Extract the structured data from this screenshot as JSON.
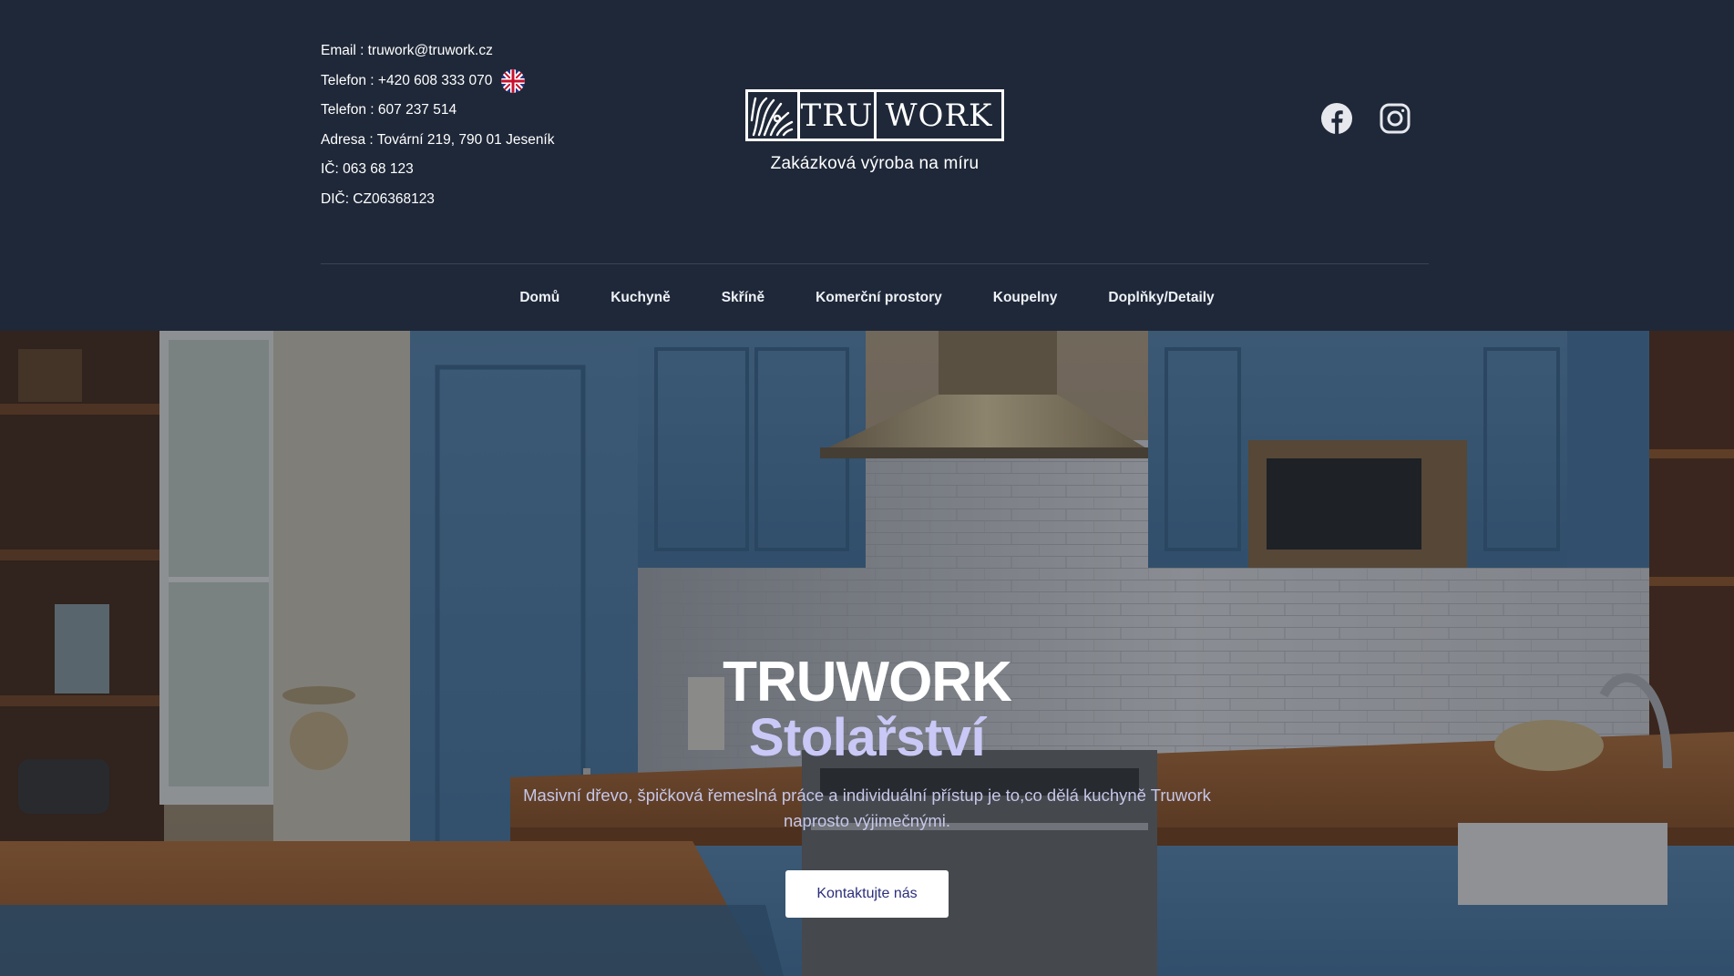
{
  "header": {
    "contact": {
      "email": "Email : truwork@truwork.cz",
      "phone1": "Telefon : +420 608 333 070",
      "phone2": "Telefon : 607 237 514",
      "address": "Adresa : Tovární 219, 790 01 Jeseník",
      "ic": "IČ: 063 68 123",
      "dic": "DIČ: CZ06368123"
    },
    "language_flag_icon": "uk-flag-icon",
    "logo": {
      "left": "TRU",
      "right": "WORK"
    },
    "tagline": "Zakázková výroba na míru",
    "socials": [
      {
        "icon": "facebook-icon"
      },
      {
        "icon": "instagram-icon"
      }
    ]
  },
  "nav": {
    "items": [
      "Domů",
      "Kuchyně",
      "Skříně",
      "Komerční prostory",
      "Koupelny",
      "Doplňky/Detaily"
    ]
  },
  "hero": {
    "title": "TRUWORK",
    "subtitle": "Stolařství",
    "description": "Masivní dřevo, špičková řemeslná práce a individuální přístup je to,co dělá kuchyně Truwork naprosto výjimečnými.",
    "cta_label": "Kontaktujte nás"
  },
  "colors": {
    "header_bg": "#1f2838",
    "accent_lavender": "#c9c8f6",
    "cta_text": "#2b2f7a"
  }
}
